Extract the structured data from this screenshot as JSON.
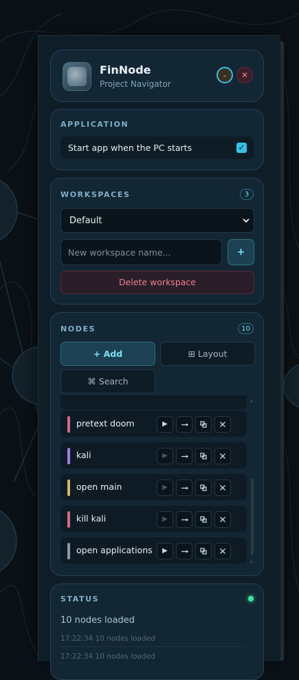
{
  "app": {
    "title": "FinNode",
    "subtitle": "Project Navigator",
    "logo_text": "FinNode",
    "minimize_label": "-",
    "close_label": "✕"
  },
  "application": {
    "heading": "APPLICATION",
    "startup_label": "Start app when the PC starts",
    "startup_checked": true,
    "check_glyph": "✓"
  },
  "workspaces": {
    "heading": "WORKSPACES",
    "count": "3",
    "selected": "Default",
    "new_placeholder": "New workspace name...",
    "add_label": "+",
    "delete_label": "Delete workspace"
  },
  "nodes": {
    "heading": "NODES",
    "count": "10",
    "add_label": "+ Add",
    "layout_label": "Layout",
    "search_label": "Search",
    "layout_icon": "⊞",
    "search_icon": "⌘",
    "play_glyph": "▶",
    "items": [
      {
        "name": "pretext doom",
        "color": "#d06a86",
        "play_enabled": true
      },
      {
        "name": "kali",
        "color": "#9b7fe0",
        "play_enabled": false
      },
      {
        "name": "open main",
        "color": "#d9b26a",
        "play_enabled": false
      },
      {
        "name": "kill kali",
        "color": "#d06a86",
        "play_enabled": false
      },
      {
        "name": "open applications",
        "color": "#8a9aa6",
        "play_enabled": true
      }
    ]
  },
  "status": {
    "heading": "STATUS",
    "summary": "10 nodes loaded",
    "log": [
      "17:22:34 10 nodes loaded",
      "17:22:34 10 nodes loaded"
    ]
  },
  "colors": {
    "accent": "#35c0e6",
    "danger": "#f07f92",
    "ok": "#3fe39b"
  }
}
